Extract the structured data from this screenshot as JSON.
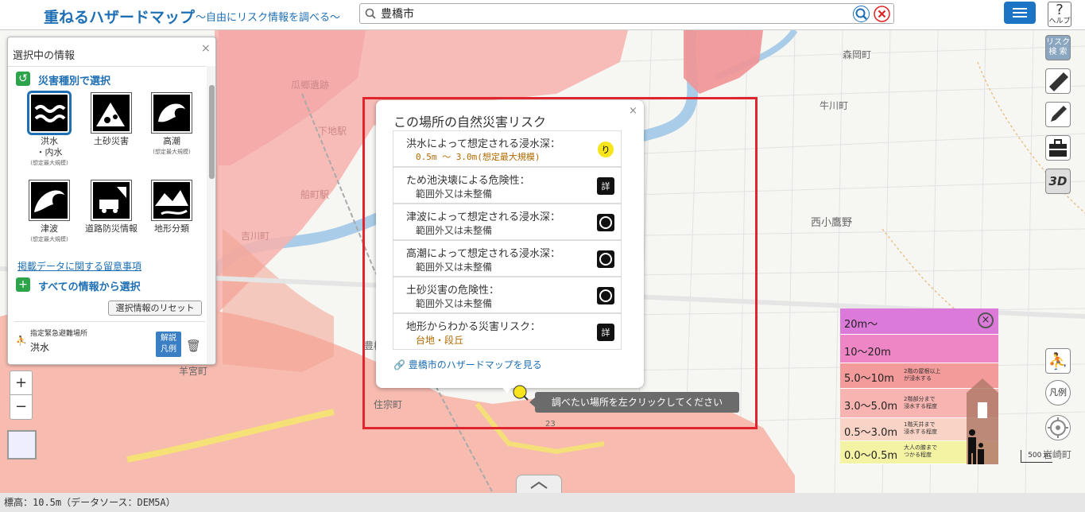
{
  "header": {
    "title": "重ねるハザードマップ",
    "subtitle": "～自由にリスク情報を調べる～",
    "search_value": "豊橋市",
    "help_label": "ヘルプ"
  },
  "map": {
    "places": [
      "森岡町",
      "牛川町",
      "西小鷹野",
      "下地駅",
      "船町駅",
      "吉川町",
      "豊橋",
      "羊宮町",
      "住宗町",
      "岩崎町",
      "瓜郷遺跡",
      "23"
    ]
  },
  "panel": {
    "title": "選択中の情報",
    "section1": "災害種別で選択",
    "categories": [
      {
        "label": "洪水\n・内水",
        "sub": "(想定最大規模)"
      },
      {
        "label": "土砂災害",
        "sub": ""
      },
      {
        "label": "高潮",
        "sub": "(想定最大規模)"
      },
      {
        "label": "津波",
        "sub": "(想定最大規模)"
      },
      {
        "label": "道路防災情報",
        "sub": ""
      },
      {
        "label": "地形分類",
        "sub": ""
      }
    ],
    "notice_link": "掲載データに関する留意事項",
    "section2": "すべての情報から選択",
    "reset_button": "選択情報のリセット",
    "selected_category": "指定緊急避難場所",
    "selected_name": "洪水",
    "legend_button": "解説\n凡例"
  },
  "popup": {
    "title": "この場所の自然災害リスク",
    "risks": [
      {
        "q": "洪水によって想定される浸水深：",
        "a": "0.5m ～ 3.0m(想定最大規模)",
        "warn": true,
        "icon": "risk-warning-icon"
      },
      {
        "q": "ため池決壊による危険性：",
        "a": "範囲外又は未整備",
        "warn": false,
        "icon": "detail-icon"
      },
      {
        "q": "津波によって想定される浸水深：",
        "a": "範囲外又は未整備",
        "warn": false,
        "icon": "risk-info-icon"
      },
      {
        "q": "高潮によって想定される浸水深：",
        "a": "範囲外又は未整備",
        "warn": false,
        "icon": "risk-info-icon"
      },
      {
        "q": "土砂災害の危険性：",
        "a": "範囲外又は未整備",
        "warn": false,
        "icon": "risk-info-icon"
      },
      {
        "q": "地形からわかる災害リスク：",
        "a": "台地・段丘",
        "warn": true,
        "icon": "detail-icon"
      }
    ],
    "hazard_link": "豊橋市のハザードマップを見る"
  },
  "tooltip": "調べたい場所を左クリックしてください",
  "legend": {
    "rows": [
      {
        "label": "20m～",
        "desc": "",
        "color": "#dc7ad9"
      },
      {
        "label": "10～20m",
        "desc": "",
        "color": "#ee86c6"
      },
      {
        "label": "5.0～10m",
        "desc": "2階の屋根以上\nが浸水する",
        "color": "#f39a9a"
      },
      {
        "label": "3.0～5.0m",
        "desc": "2階部分まで\n浸水する程度",
        "color": "#f7b4b0"
      },
      {
        "label": "0.5～3.0m",
        "desc": "1階天井まで\n浸水する程度",
        "color": "#f9d4c6"
      },
      {
        "label": "0.0～0.5m",
        "desc": "大人の膝まで\nつかる程度",
        "color": "#f4f3a4"
      }
    ]
  },
  "tools": {
    "risk_search": "リスク\n検 索",
    "legend_btn": "凡例",
    "threed": "3D"
  },
  "scale": "500 m",
  "statusbar": "標高：10.5m（データソース：DEM5A）"
}
